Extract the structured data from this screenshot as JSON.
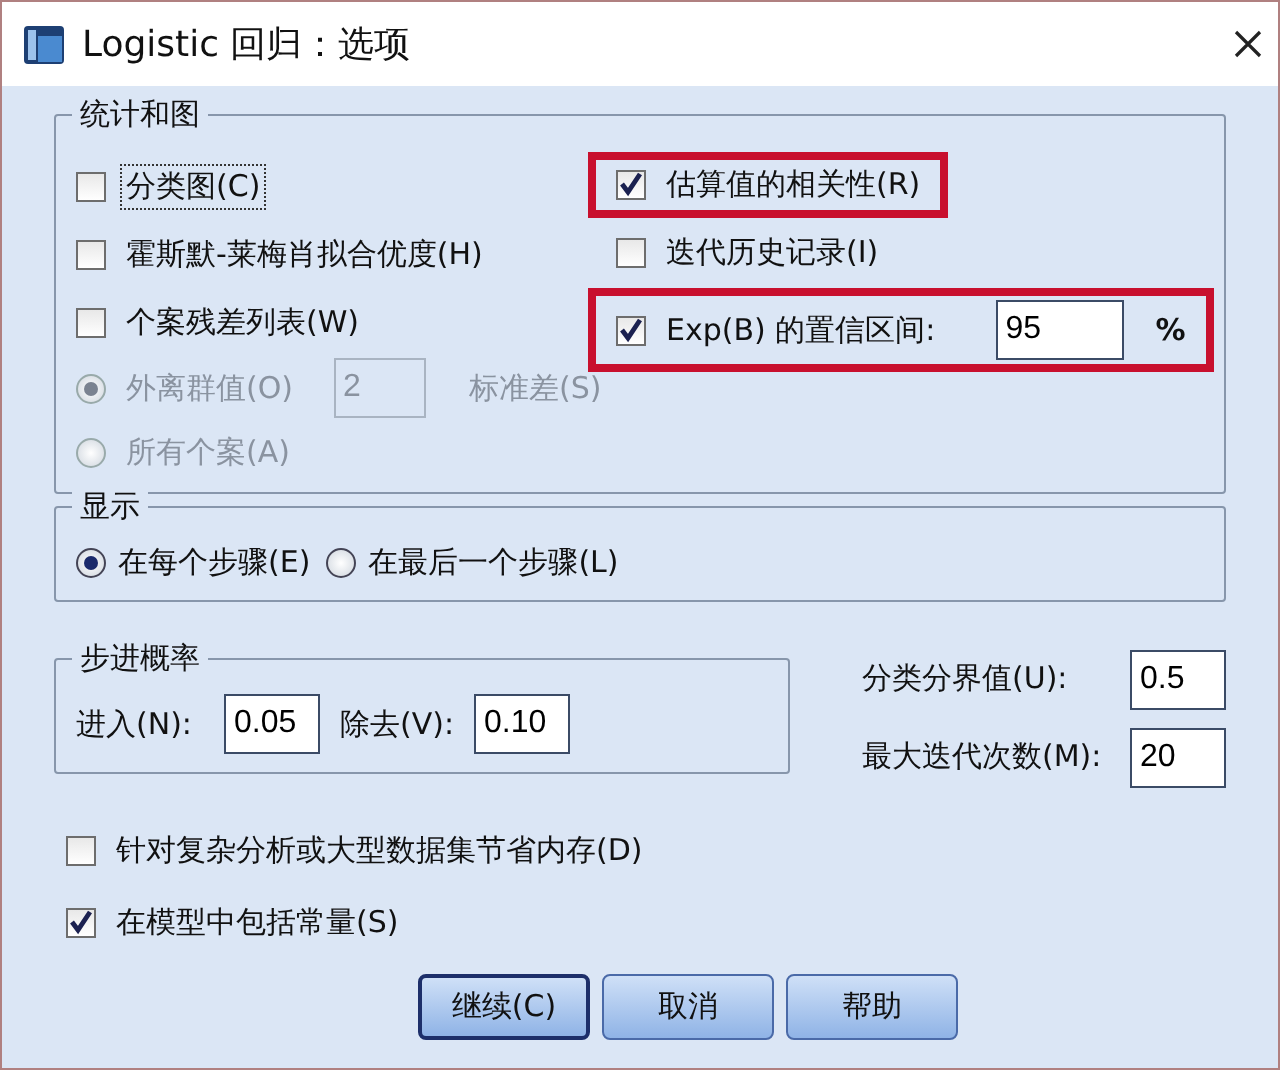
{
  "window": {
    "title": "Logistic 回归：选项"
  },
  "statistics_group": {
    "title": "统计和图",
    "left_items": [
      {
        "kind": "checkbox",
        "label": "分类图(C)",
        "checked": false,
        "focused": true,
        "disabled": false
      },
      {
        "kind": "checkbox",
        "label": "霍斯默-莱梅肖拟合优度(H)",
        "checked": false,
        "focused": false,
        "disabled": false
      },
      {
        "kind": "checkbox",
        "label": "个案残差列表(W)",
        "checked": false,
        "focused": false,
        "disabled": false
      },
      {
        "kind": "radio",
        "label": "外离群值(O)",
        "selected": true,
        "disabled": true,
        "value": "2",
        "suffix": "标准差(S)"
      },
      {
        "kind": "radio",
        "label": "所有个案(A)",
        "selected": false,
        "disabled": true
      }
    ],
    "right_items": [
      {
        "kind": "checkbox",
        "label": "估算值的相关性(R)",
        "checked": true,
        "highlighted": true
      },
      {
        "kind": "checkbox",
        "label": "迭代历史记录(I)",
        "checked": false,
        "highlighted": false
      },
      {
        "kind": "checkbox",
        "label": "Exp(B) 的置信区间:",
        "checked": true,
        "highlighted": true,
        "value": "95",
        "suffix": "%"
      }
    ]
  },
  "display_group": {
    "title": "显示",
    "options": [
      {
        "label": "在每个步骤(E)",
        "selected": true
      },
      {
        "label": "在最后一个步骤(L)",
        "selected": false
      }
    ]
  },
  "stepwise_group": {
    "title": "步进概率",
    "fields": [
      {
        "label": "进入(N):",
        "value": "0.05"
      },
      {
        "label": "除去(V):",
        "value": "0.10"
      }
    ]
  },
  "right_fields": [
    {
      "label": "分类分界值(U):",
      "value": "0.5"
    },
    {
      "label": "最大迭代次数(M):",
      "value": "20"
    }
  ],
  "bottom_checks": [
    {
      "label": "针对复杂分析或大型数据集节省内存(D)",
      "checked": false
    },
    {
      "label": "在模型中包括常量(S)",
      "checked": true
    }
  ],
  "buttons": [
    {
      "label": "继续(C)",
      "default": true
    },
    {
      "label": "取消",
      "default": false
    },
    {
      "label": "帮助",
      "default": false
    }
  ]
}
